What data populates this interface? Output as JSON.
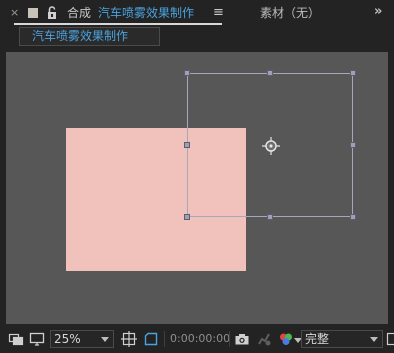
{
  "panel": {
    "close_glyph": "×",
    "label_color_swatch": "#c8c3b8",
    "lock_icon": "lock-icon",
    "tab_prefix": "合成",
    "comp_name": "汽车喷雾效果制作",
    "menu_glyph": "≡",
    "footage_tab": "素材（无）",
    "overflow_glyph": "»"
  },
  "breadcrumb": {
    "comp_name": "汽车喷雾效果制作",
    "accent_color": "#4aa3df"
  },
  "viewer": {
    "background_color": "#575757",
    "layer_color": "#f0c2bb",
    "bounding_box_color": "#a7a7bb"
  },
  "toolbar": {
    "toggle_icon": "mask-view-icon",
    "monitor_icon": "monitor-icon",
    "zoom": "25%",
    "grid_icon": "grid-guides-icon",
    "region_icon": "region-of-interest-icon",
    "timecode": "0:00:00:00",
    "snapshot_icon": "camera-icon",
    "show_snapshot_icon": "show-snapshot-icon",
    "color_icon": "color-channels-icon",
    "resolution": "完整",
    "more_icon": "fast-preview-icon"
  }
}
